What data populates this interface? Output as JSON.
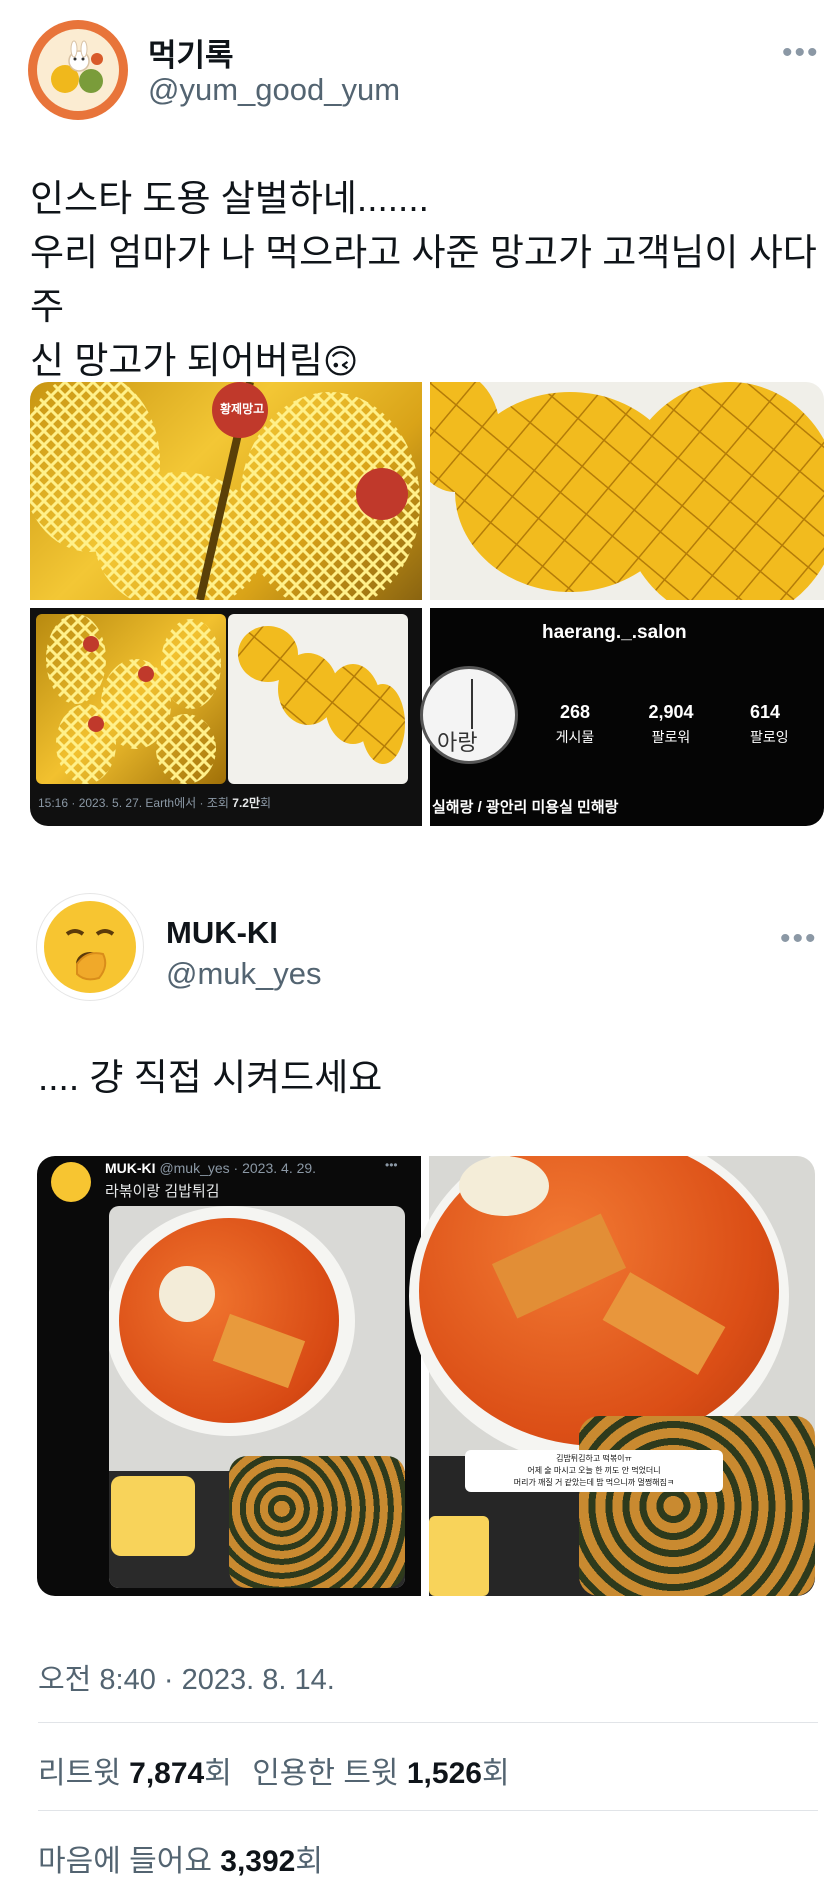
{
  "tweet1": {
    "name": "먹기록",
    "handle": "@yum_good_yum",
    "more": "•••",
    "lines": [
      "인스타 도용 살벌하네.......",
      "우리 엄마가 나 먹으라고 사준 망고가 고객님이 사다주",
      "신 망고가 되어버림"
    ],
    "emoji": "🙃",
    "box_label": "황제망고",
    "embed_meta": "15:16 · 2023. 5. 27. Earth에서 · 조회",
    "embed_views": "7.2만",
    "embed_views_suffix": "회",
    "insta": {
      "username": "haerang._.salon",
      "stats": [
        {
          "value": "268",
          "label": "게시물"
        },
        {
          "value": "2,904",
          "label": "팔로워"
        },
        {
          "value": "614",
          "label": "팔로잉"
        }
      ],
      "bio": "실해랑 / 광안리 미용실 민해랑",
      "logo_text": "아랑"
    }
  },
  "tweet2": {
    "name": "MUK-KI",
    "handle": "@muk_yes",
    "more": "•••",
    "text": ".... 걍 직접 시켜드세요",
    "quoted": {
      "name": "MUK-KI",
      "handle": "@muk_yes · 2023. 4. 29.",
      "text": "라볶이랑 김밥튀김",
      "more": "•••"
    },
    "caption_lines": [
      "김밥튀김하고 떡볶이ㅠ",
      "어제 술 마시고 오늘 한 끼도 안 먹었더니",
      "머리가 깨질 거 같았는데 밥 먹으니까 멀쩡해짐ㅋ"
    ]
  },
  "footer": {
    "timestamp": "오전 8:40 · 2023. 8. 14.",
    "retweet_label": "리트윗",
    "retweet_count": "7,874",
    "count_suffix": "회",
    "quote_label": "인용한 트윗",
    "quote_count": "1,526",
    "like_label": "마음에 들어요",
    "like_count": "3,392"
  },
  "colors": {
    "mango": "#f0b81c",
    "sauce": "#e0501c",
    "dark": "#101010",
    "muted": "#536471"
  }
}
